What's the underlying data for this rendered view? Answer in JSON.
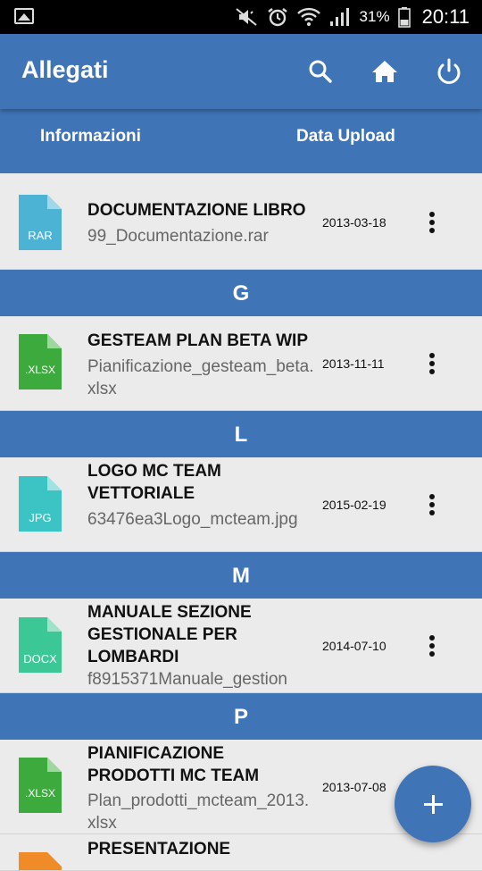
{
  "status_bar": {
    "battery_percent": "31%",
    "time": "20:11",
    "icons": [
      "image-icon",
      "mute-icon",
      "alarm-icon",
      "wifi-icon",
      "signal-icon",
      "battery-icon"
    ]
  },
  "appbar": {
    "title": "Allegati",
    "actions": [
      "search-icon",
      "home-icon",
      "power-icon"
    ],
    "color": "#3f74b7"
  },
  "columns": {
    "info": "Informazioni",
    "upload": "Data Upload"
  },
  "items": [
    {
      "name": "DOCUMENTAZIONE LIBRO",
      "file": "99_Documentazione.rar",
      "date": "2013-03-18",
      "type": "RAR",
      "color": "#4cb3d4"
    },
    {
      "name": "GESTEAM PLAN BETA WIP",
      "file": "Pianificazione_gesteam_beta.xlsx",
      "date": "2013-11-11",
      "type": ".XLSX",
      "color": "#3caa3c"
    },
    {
      "name": "LOGO MC TEAM VETTORIALE",
      "file": "63476ea3Logo_mcteam.jpg",
      "date": "2015-02-19",
      "type": "JPG",
      "color": "#3cc3c3"
    },
    {
      "name": "MANUALE SEZIONE GESTIONALE PER LOMBARDI",
      "file": "f8915371Manuale_gestion",
      "date": "2014-07-10",
      "type": "DOCX",
      "color": "#3cc896"
    },
    {
      "name": "PIANIFICAZIONE PRODOTTI MC TEAM",
      "file": "Plan_prodotti_mcteam_2013.xlsx",
      "date": "2013-07-08",
      "type": ".XLSX",
      "color": "#3caa3c"
    },
    {
      "name": "PRESENTAZIONE",
      "file": "",
      "date": "",
      "type": "",
      "color": "#f08c28"
    }
  ],
  "sections": [
    "G",
    "L",
    "M",
    "P"
  ],
  "fab": {
    "icon": "plus-icon"
  }
}
